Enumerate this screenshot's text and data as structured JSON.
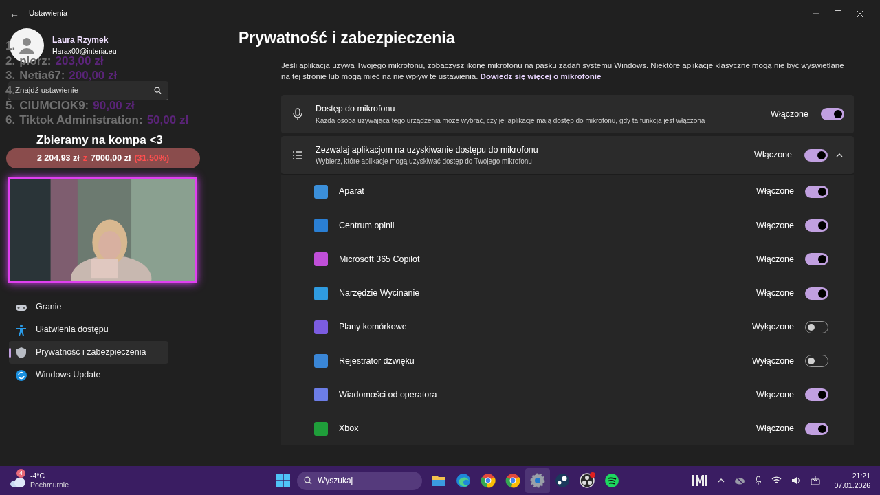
{
  "window": {
    "title": "Ustawienia",
    "back": "←"
  },
  "profile": {
    "name": "Laura Rzymek",
    "email": "Harax00@interia.eu"
  },
  "search": {
    "placeholder": "Znajdź ustawienie"
  },
  "sidebar": {
    "items": [
      {
        "label": "Granie",
        "selected": false
      },
      {
        "label": "Ułatwienia dostępu",
        "selected": false
      },
      {
        "label": "Prywatność i zabezpieczenia",
        "selected": true
      },
      {
        "label": "Windows Update",
        "selected": false
      }
    ]
  },
  "stream_overlay": {
    "leaderboard": [
      {
        "rank": "1."
      },
      {
        "rank": "2.",
        "name": "plorz:",
        "amount": "203,00 zł"
      },
      {
        "rank": "3.",
        "name": "Netia67:",
        "amount": "200,00 zł"
      },
      {
        "rank": "4."
      },
      {
        "rank": "5.",
        "name": "CIUMCIOK9:",
        "amount": "90,00 zł"
      },
      {
        "rank": "6.",
        "name": "Tiktok Administration:",
        "amount": "50,00 zł"
      }
    ],
    "goal": {
      "title": "Zbieramy na kompa <3",
      "raised": "2 204,93 zł",
      "of": "z",
      "target": "7000,00 zł",
      "percent": "(31.50%)"
    }
  },
  "page": {
    "title": "Prywatność i zabezpieczenia",
    "description": "Jeśli aplikacja używa Twojego mikrofonu, zobaczysz ikonę mikrofonu na pasku zadań systemu Windows. Niektóre aplikacje klasyczne mogą nie być wyświetlane na tej stronie lub mogą mieć na nie wpływ te ustawienia.",
    "link": "Dowiedz się więcej o mikrofonie"
  },
  "cards": [
    {
      "title": "Dostęp do mikrofonu",
      "subtitle": "Każda osoba używająca tego urządzenia może wybrać, czy jej aplikacje mają dostęp do mikrofonu, gdy ta funkcja jest włączona",
      "state_label": "Włączone",
      "on": true
    },
    {
      "title": "Zezwalaj aplikacjom na uzyskiwanie dostępu do mikrofonu",
      "subtitle": "Wybierz, które aplikacje mogą uzyskiwać dostęp do Twojego mikrofonu",
      "state_label": "Włączone",
      "on": true,
      "expanded": true
    }
  ],
  "apps": [
    {
      "name": "Aparat",
      "state_label": "Włączone",
      "on": true,
      "color": "#3b8fd9"
    },
    {
      "name": "Centrum opinii",
      "state_label": "Włączone",
      "on": true,
      "color": "#2a7fd4"
    },
    {
      "name": "Microsoft 365 Copilot",
      "state_label": "Włączone",
      "on": true,
      "color": "#c04fd8"
    },
    {
      "name": "Narzędzie Wycinanie",
      "state_label": "Włączone",
      "on": true,
      "color": "#2f9be0"
    },
    {
      "name": "Plany komórkowe",
      "state_label": "Wyłączone",
      "on": false,
      "color": "#7b5ce0"
    },
    {
      "name": "Rejestrator dźwięku",
      "state_label": "Wyłączone",
      "on": false,
      "color": "#3a86d6"
    },
    {
      "name": "Wiadomości od operatora",
      "state_label": "Włączone",
      "on": true,
      "color": "#6c7de6"
    },
    {
      "name": "Xbox",
      "state_label": "Włączone",
      "on": true,
      "color": "#1f9e3a"
    }
  ],
  "taskbar": {
    "weather": {
      "badge": "4",
      "temp": "-4°C",
      "condition": "Pochmurnie"
    },
    "search": {
      "placeholder": "Wyszukaj"
    },
    "apps": [
      {
        "selected": false
      },
      {
        "selected": false
      },
      {
        "selected": false
      },
      {
        "selected": false
      },
      {
        "selected": true
      },
      {
        "selected": false
      },
      {
        "selected": false
      },
      {
        "selected": false
      }
    ],
    "time": "21:21",
    "date": "07.01.2026"
  }
}
